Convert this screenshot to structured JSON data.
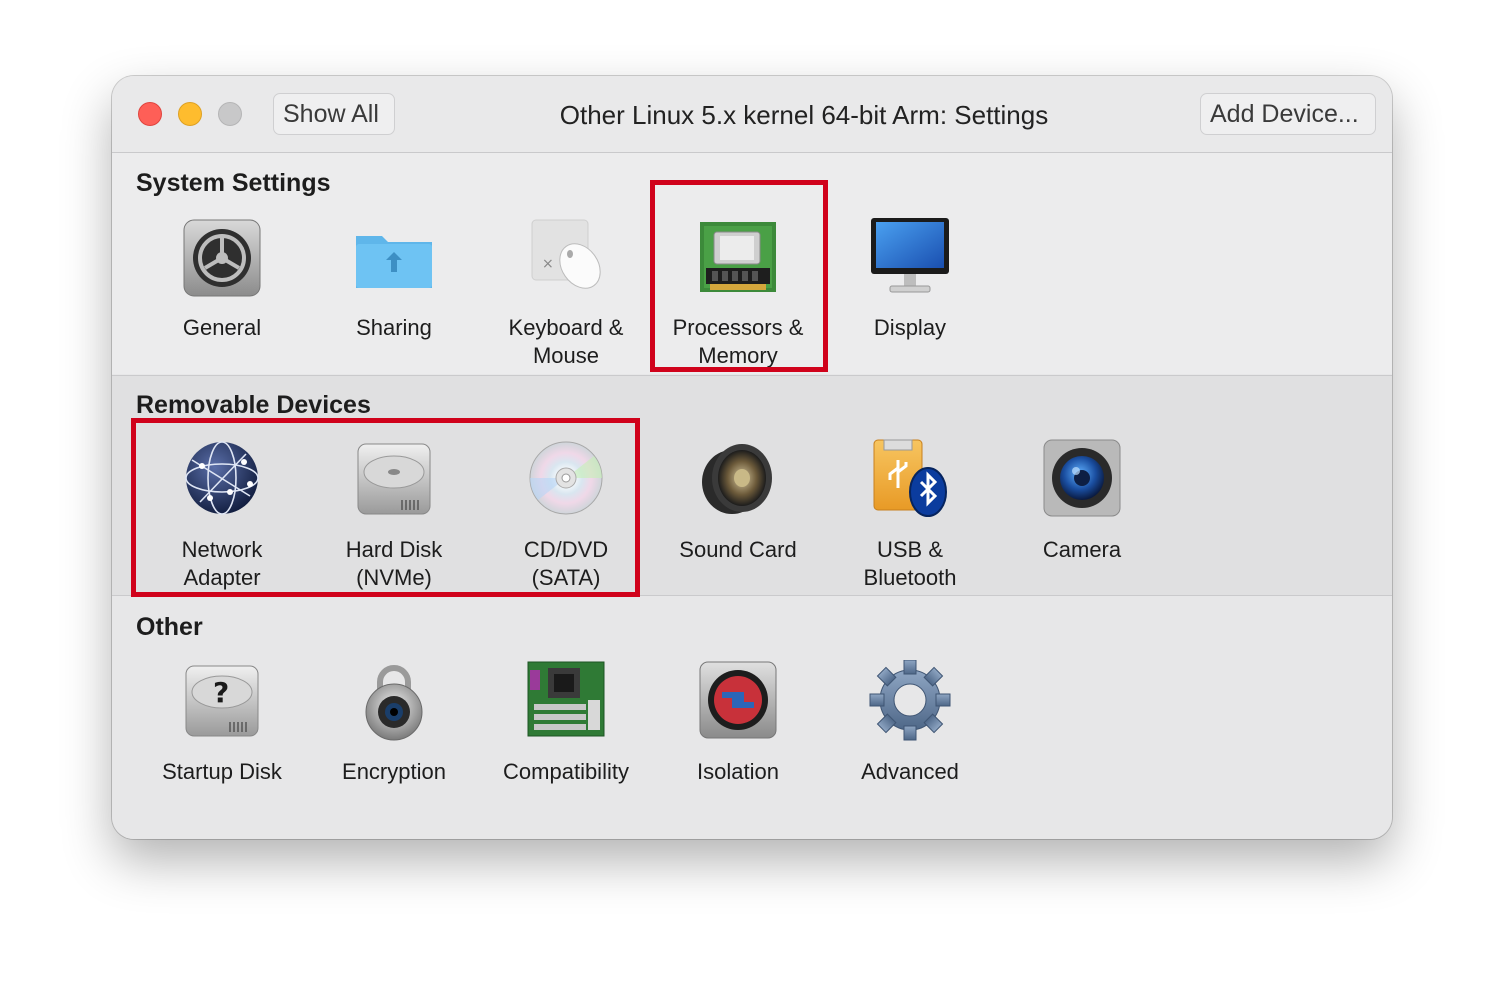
{
  "window": {
    "title": "Other Linux 5.x kernel 64-bit Arm: Settings",
    "show_all": "Show All",
    "add_device": "Add Device..."
  },
  "sections": {
    "system": {
      "title": "System Settings",
      "items": [
        {
          "label": "General",
          "icon": "general-icon"
        },
        {
          "label": "Sharing",
          "icon": "sharing-folder-icon"
        },
        {
          "label": "Keyboard &\nMouse",
          "icon": "keyboard-mouse-icon"
        },
        {
          "label": "Processors &\nMemory",
          "icon": "processors-memory-icon"
        },
        {
          "label": "Display",
          "icon": "display-icon"
        }
      ]
    },
    "removable": {
      "title": "Removable Devices",
      "items": [
        {
          "label": "Network\nAdapter",
          "icon": "network-globe-icon"
        },
        {
          "label": "Hard Disk\n(NVMe)",
          "icon": "hard-disk-icon"
        },
        {
          "label": "CD/DVD\n(SATA)",
          "icon": "cd-dvd-icon"
        },
        {
          "label": "Sound Card",
          "icon": "speaker-icon"
        },
        {
          "label": "USB &\nBluetooth",
          "icon": "usb-bluetooth-icon"
        },
        {
          "label": "Camera",
          "icon": "camera-icon"
        }
      ]
    },
    "other": {
      "title": "Other",
      "items": [
        {
          "label": "Startup Disk",
          "icon": "startup-disk-icon"
        },
        {
          "label": "Encryption",
          "icon": "padlock-icon"
        },
        {
          "label": "Compatibility",
          "icon": "motherboard-icon"
        },
        {
          "label": "Isolation",
          "icon": "isolation-icon"
        },
        {
          "label": "Advanced",
          "icon": "advanced-gear-icon"
        }
      ]
    }
  },
  "colors": {
    "highlight": "#d0021b",
    "close": "#fe5f57",
    "minimize": "#febc2e",
    "zoom_inactive": "#c8c8c9"
  }
}
